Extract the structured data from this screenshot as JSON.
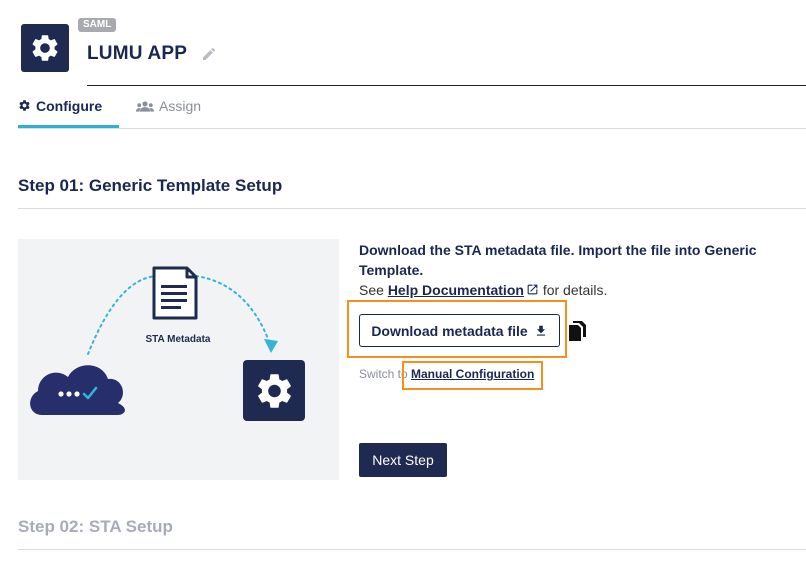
{
  "app": {
    "title": "LUMU APP",
    "badge": "SAML",
    "logo_icon": "gear-icon",
    "edit_icon": "pencil-icon"
  },
  "tabs": [
    {
      "label": "Configure",
      "icon": "gear-icon",
      "active": true
    },
    {
      "label": "Assign",
      "icon": "users-icon",
      "active": false
    }
  ],
  "step1": {
    "title": "Step 01: Generic Template Setup",
    "illustration": {
      "label": "STA Metadata",
      "icons": [
        "document-icon",
        "cloud-icon",
        "gear-icon"
      ]
    },
    "instruction_bold": "Download the STA metadata file. Import the file into Generic Template.",
    "see_prefix": "See",
    "help_link": "Help Documentation",
    "help_suffix": "for details.",
    "download_button": "Download metadata file",
    "switch_prefix": "Switch to",
    "manual_link": "Manual Configuration",
    "next_button": "Next Step"
  },
  "step2": {
    "title": "Step 02: STA Setup"
  },
  "colors": {
    "primary": "#1e2a4f",
    "accent": "#2db0d8",
    "highlight": "#f5901f",
    "muted": "#a7acb8"
  }
}
